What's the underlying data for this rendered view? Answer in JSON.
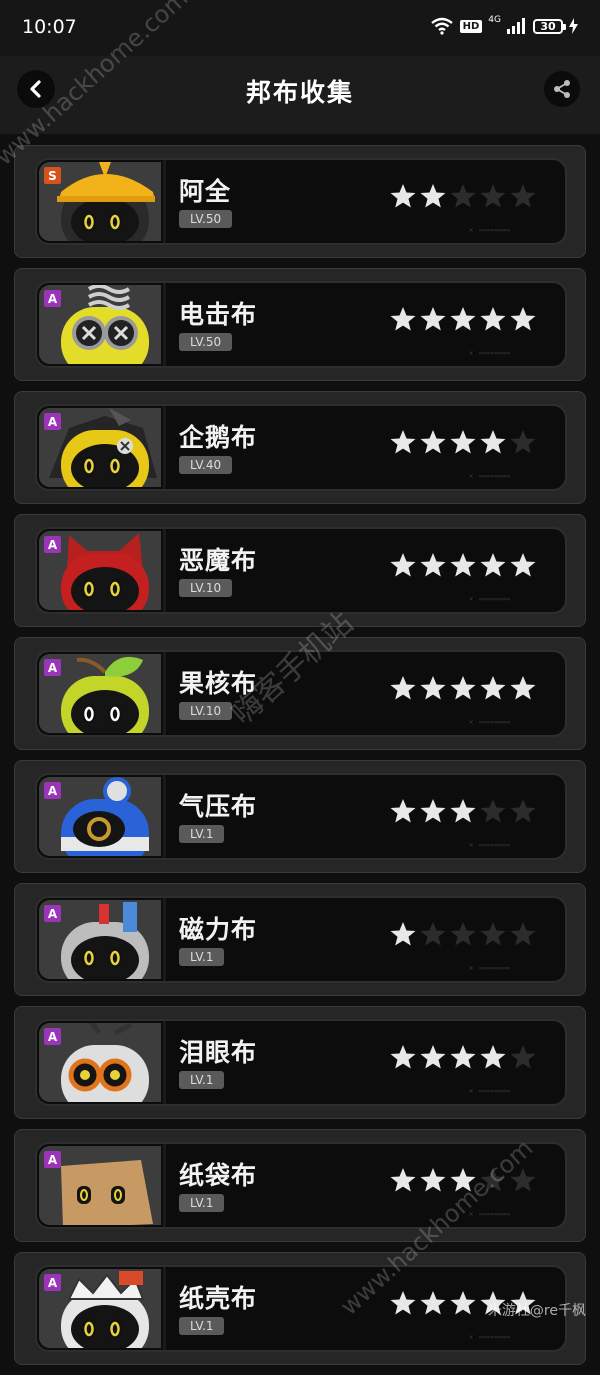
{
  "status_bar": {
    "time": "10:07",
    "hd": "HD",
    "network": "4G",
    "battery": "30"
  },
  "header": {
    "title": "邦布收集",
    "back_icon": "chevron-left-icon",
    "share_icon": "share-icon"
  },
  "colors": {
    "star_filled": "#e8e8e8",
    "star_empty": "#2c2c2c",
    "rank_S": "#d6541c",
    "rank_A": "#9b34b8"
  },
  "bangboos": [
    {
      "name": "阿全",
      "level": "LV.50",
      "rank": "S",
      "stars": 2,
      "character": "hard-hat-bangboo"
    },
    {
      "name": "电击布",
      "level": "LV.50",
      "rank": "A",
      "stars": 5,
      "character": "coil-bangboo"
    },
    {
      "name": "企鹅布",
      "level": "LV.40",
      "rank": "A",
      "stars": 4,
      "character": "penguin-bangboo"
    },
    {
      "name": "恶魔布",
      "level": "LV.10",
      "rank": "A",
      "stars": 5,
      "character": "devil-bangboo"
    },
    {
      "name": "果核布",
      "level": "LV.10",
      "rank": "A",
      "stars": 5,
      "character": "leaf-bangboo"
    },
    {
      "name": "气压布",
      "level": "LV.1",
      "rank": "A",
      "stars": 3,
      "character": "gauge-bangboo"
    },
    {
      "name": "磁力布",
      "level": "LV.1",
      "rank": "A",
      "stars": 1,
      "character": "magnet-bangboo"
    },
    {
      "name": "泪眼布",
      "level": "LV.1",
      "rank": "A",
      "stars": 4,
      "character": "goggles-bangboo"
    },
    {
      "name": "纸袋布",
      "level": "LV.1",
      "rank": "A",
      "stars": 3,
      "character": "paper-bag-bangboo"
    },
    {
      "name": "纸壳布",
      "level": "LV.1",
      "rank": "A",
      "stars": 5,
      "character": "cardboard-bangboo"
    }
  ],
  "watermarks": {
    "site_url": "www.hackhome.com",
    "site_name": "嗨客手机站",
    "credit": "米游社@re千枫"
  }
}
